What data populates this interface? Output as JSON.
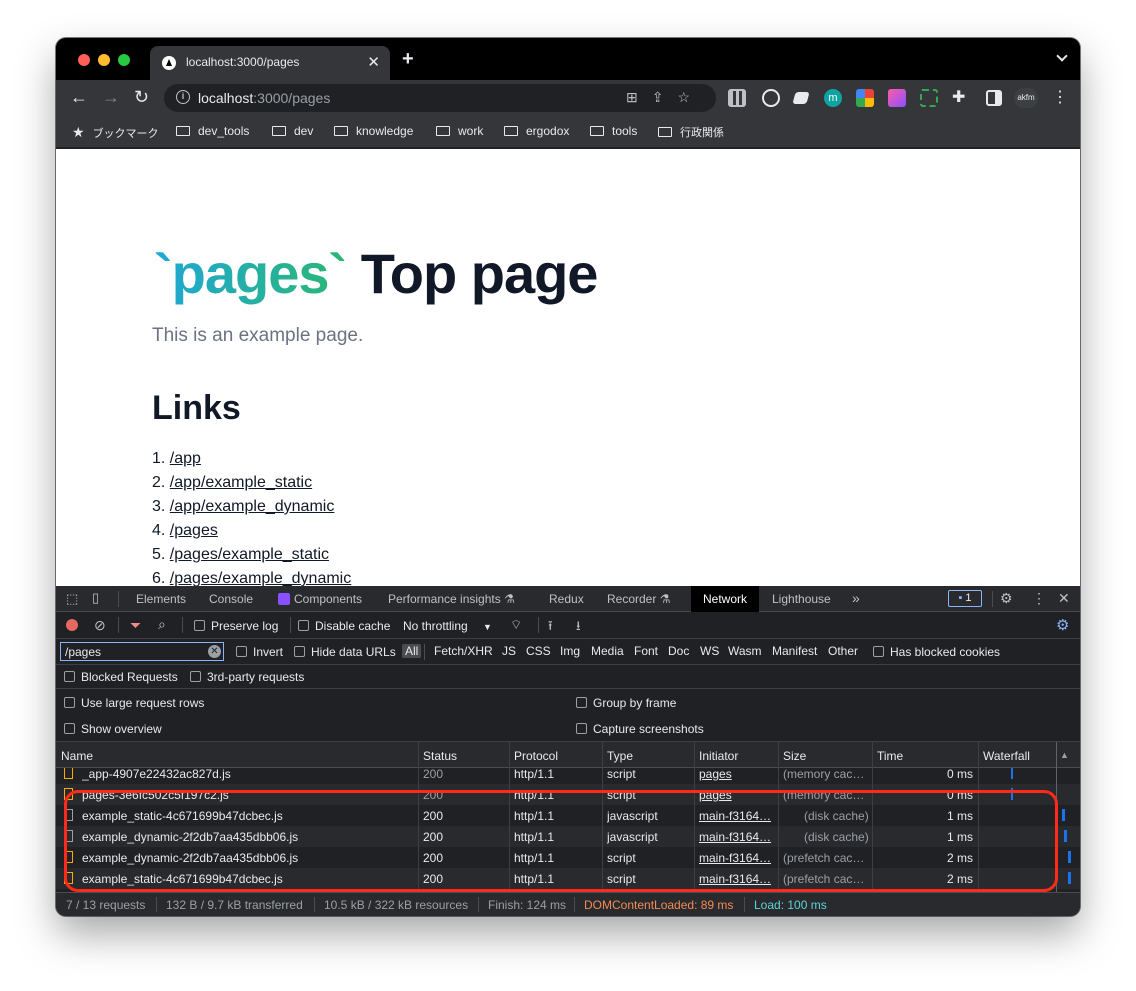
{
  "browser": {
    "tab_title": "localhost:3000/pages",
    "url_host": "localhost",
    "url_path": ":3000/pages",
    "profile_label": "akfm"
  },
  "bookmarks": [
    {
      "label": "ブックマーク",
      "icon": "star-icon"
    },
    {
      "label": "dev_tools",
      "icon": "folder-icon"
    },
    {
      "label": "dev",
      "icon": "folder-icon"
    },
    {
      "label": "knowledge",
      "icon": "folder-icon"
    },
    {
      "label": "work",
      "icon": "folder-icon"
    },
    {
      "label": "ergodox",
      "icon": "folder-icon"
    },
    {
      "label": "tools",
      "icon": "folder-icon"
    },
    {
      "label": "行政関係",
      "icon": "folder-icon"
    }
  ],
  "page": {
    "title_code": "`pages`",
    "title_rest": " Top page",
    "subtitle": "This is an example page.",
    "links_heading": "Links",
    "links": [
      {
        "num": "1.",
        "href": "/app"
      },
      {
        "num": "2.",
        "href": "/app/example_static"
      },
      {
        "num": "3.",
        "href": "/app/example_dynamic"
      },
      {
        "num": "4.",
        "href": "/pages"
      },
      {
        "num": "5.",
        "href": "/pages/example_static"
      },
      {
        "num": "6.",
        "href": "/pages/example_dynamic"
      }
    ]
  },
  "devtools": {
    "tabs": [
      "Elements",
      "Console",
      "Components",
      "Performance insights",
      "Redux",
      "Recorder",
      "Network",
      "Lighthouse"
    ],
    "active_tab": "Network",
    "message_count": "1",
    "preserve_log": "Preserve log",
    "disable_cache": "Disable cache",
    "throttling": "No throttling",
    "filter_value": "/pages",
    "invert": "Invert",
    "hide_data_urls": "Hide data URLs",
    "type_filters": [
      "All",
      "Fetch/XHR",
      "JS",
      "CSS",
      "Img",
      "Media",
      "Font",
      "Doc",
      "WS",
      "Wasm",
      "Manifest",
      "Other"
    ],
    "has_blocked_cookies": "Has blocked cookies",
    "blocked_requests": "Blocked Requests",
    "third_party": "3rd-party requests",
    "large_rows": "Use large request rows",
    "group_by_frame": "Group by frame",
    "show_overview": "Show overview",
    "capture_screenshots": "Capture screenshots",
    "columns": [
      "Name",
      "Status",
      "Protocol",
      "Type",
      "Initiator",
      "Size",
      "Time",
      "Waterfall"
    ],
    "rows": [
      {
        "name": "_app-4907e22432ac827d.js",
        "status": "200",
        "protocol": "http/1.1",
        "type": "script",
        "initiator": "pages",
        "size": "(memory cac…",
        "time": "0 ms",
        "icon": "script"
      },
      {
        "name": "pages-3e6fc502c5f197c2.js",
        "status": "200",
        "protocol": "http/1.1",
        "type": "script",
        "initiator": "pages",
        "size": "(memory cac…",
        "time": "0 ms",
        "icon": "script"
      },
      {
        "name": "example_static-4c671699b47dcbec.js",
        "status": "200",
        "protocol": "http/1.1",
        "type": "javascript",
        "initiator": "main-f3164…",
        "size": "(disk cache)",
        "time": "1 ms",
        "icon": "doc"
      },
      {
        "name": "example_dynamic-2f2db7aa435dbb06.js",
        "status": "200",
        "protocol": "http/1.1",
        "type": "javascript",
        "initiator": "main-f3164…",
        "size": "(disk cache)",
        "time": "1 ms",
        "icon": "doc"
      },
      {
        "name": "example_dynamic-2f2db7aa435dbb06.js",
        "status": "200",
        "protocol": "http/1.1",
        "type": "script",
        "initiator": "main-f3164…",
        "size": "(prefetch cac…",
        "time": "2 ms",
        "icon": "script"
      },
      {
        "name": "example_static-4c671699b47dcbec.js",
        "status": "200",
        "protocol": "http/1.1",
        "type": "script",
        "initiator": "main-f3164…",
        "size": "(prefetch cac…",
        "time": "2 ms",
        "icon": "script"
      }
    ],
    "status_bar": {
      "requests": "7 / 13 requests",
      "transferred": "132 B / 9.7 kB transferred",
      "resources": "10.5 kB / 322 kB resources",
      "finish": "Finish: 124 ms",
      "dom_content_loaded": "DOMContentLoaded: 89 ms",
      "load": "Load: 100 ms"
    }
  },
  "colors": {
    "dom_content_loaded": "#f28b54",
    "load": "#5cd5d5",
    "highlight": "#ff2a1a"
  }
}
